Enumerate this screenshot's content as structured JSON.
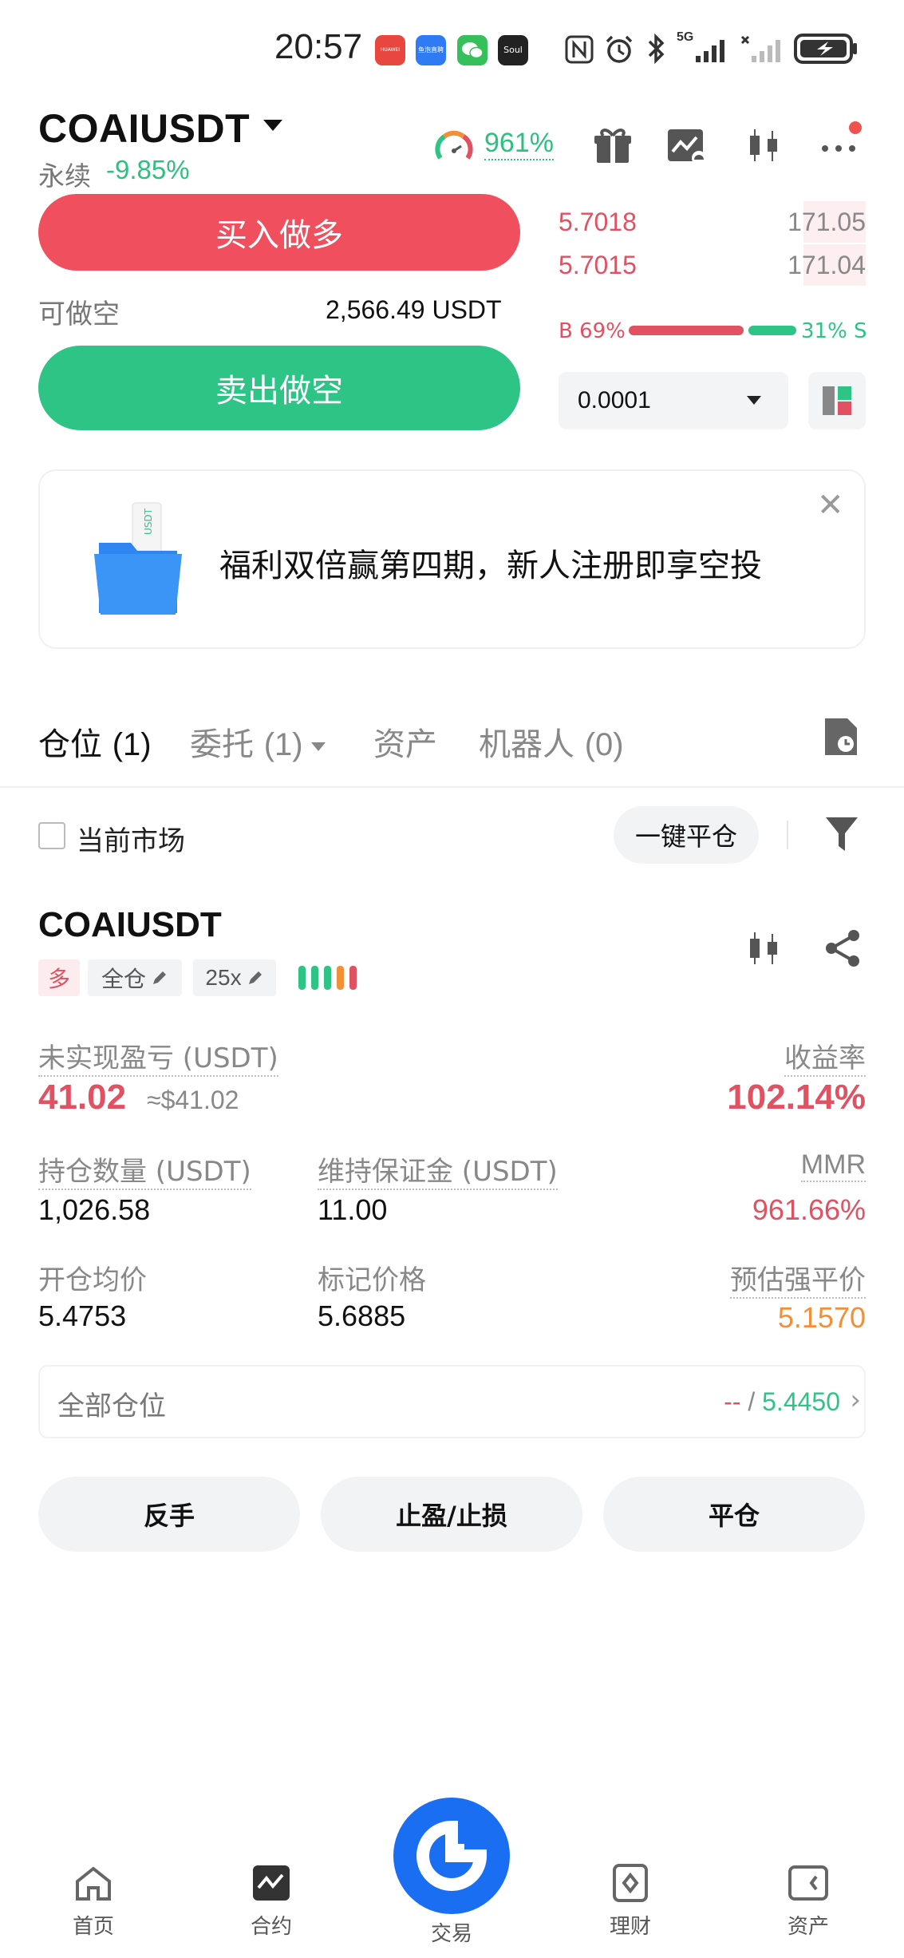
{
  "status_bar": {
    "time": "20:57",
    "apps": [
      "HUAWEI",
      "鱼泡直聘",
      "WeChat",
      "Soul"
    ],
    "net": "5G"
  },
  "header": {
    "pair": "COAIUSDT",
    "type": "永续",
    "change_pct": "-9.85%",
    "sentiment_pct": "961%"
  },
  "trade": {
    "buy_label": "买入做多",
    "sell_label": "卖出做空",
    "available_label": "可做空",
    "available_value": "2,566.49 USDT"
  },
  "orderbook": {
    "rows": [
      {
        "price": "5.7018",
        "qty": "171.05"
      },
      {
        "price": "5.7015",
        "qty": "171.04"
      }
    ],
    "buy_ratio_label": "B 69%",
    "sell_ratio_label": "31% S",
    "buy_ratio": 0.69,
    "precision": "0.0001"
  },
  "promo": {
    "text": "福利双倍赢第四期，新人注册即享空投",
    "close": "✕",
    "badge": "USDT"
  },
  "tabs": [
    {
      "label": "仓位",
      "count": "(1)"
    },
    {
      "label": "委托",
      "count": "(1)"
    },
    {
      "label": "资产",
      "count": ""
    },
    {
      "label": "机器人",
      "count": "(0)"
    }
  ],
  "filter": {
    "current_market": "当前市场",
    "close_all": "一键平仓"
  },
  "position": {
    "symbol": "COAIUSDT",
    "side": "多",
    "margin_mode": "全仓",
    "leverage": "25x",
    "unrealized_label": "未实现盈亏 (USDT)",
    "unrealized_value": "41.02",
    "unrealized_approx": "≈$41.02",
    "roe_label": "收益率",
    "roe_value": "102.14%",
    "size_label": "持仓数量 (USDT)",
    "size_value": "1,026.58",
    "maint_label": "维持保证金 (USDT)",
    "maint_value": "11.00",
    "mmr_label": "MMR",
    "mmr_value": "961.66%",
    "entry_label": "开仓均价",
    "entry_value": "5.4753",
    "mark_label": "标记价格",
    "mark_value": "5.6885",
    "liq_label": "预估强平价",
    "liq_value": "5.1570",
    "all_pos_label": "全部仓位",
    "all_pos_dash": "--",
    "all_pos_slash": " / ",
    "all_pos_price": "5.4450",
    "actions": [
      "反手",
      "止盈/止损",
      "平仓"
    ]
  },
  "nav": [
    {
      "label": "首页"
    },
    {
      "label": "合约"
    },
    {
      "label": "交易"
    },
    {
      "label": "理财"
    },
    {
      "label": "资产"
    }
  ],
  "colors": {
    "red": "#e05162",
    "green": "#2ec486",
    "orange": "#f0913a",
    "brand_blue": "#1a6ef2"
  }
}
